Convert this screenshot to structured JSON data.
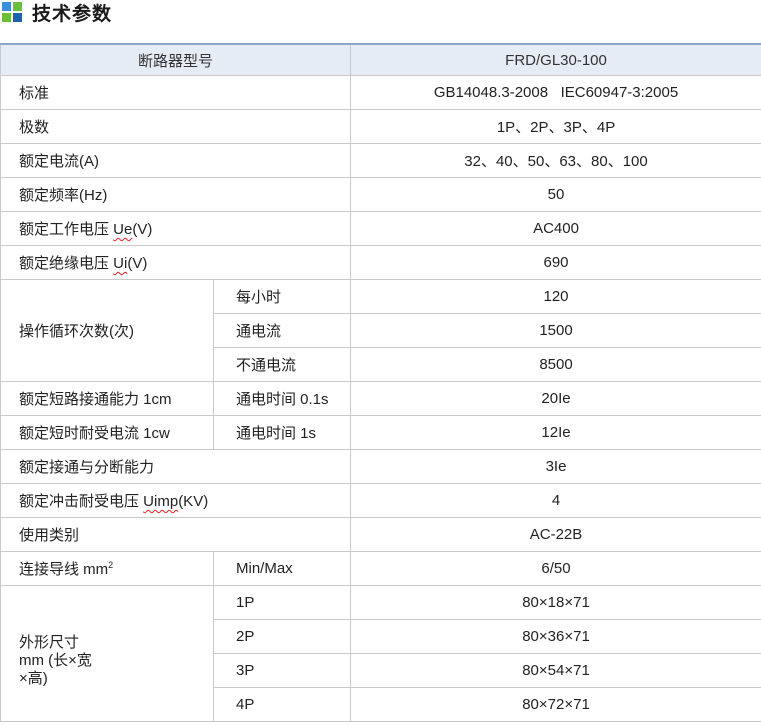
{
  "page": {
    "title": "技术参数"
  },
  "table": {
    "header": {
      "label": "断路器型号",
      "value": "FRD/GL30-100"
    },
    "rows": {
      "standard": {
        "label": "标准",
        "value": "GB14048.3-2008   IEC60947-3:2005"
      },
      "poles": {
        "label": "极数",
        "value": "1P、2P、3P、4P"
      },
      "current": {
        "label": "额定电流(A)",
        "value": "32、40、50、63、80、100"
      },
      "frequency": {
        "label": "额定频率(Hz)",
        "value": "50"
      },
      "voltage_ue": {
        "label_prefix": "额定工作电压 ",
        "label_unit": "Ue",
        "label_suffix": "(V)",
        "value": "AC400"
      },
      "voltage_ui": {
        "label_prefix": "额定绝缘电压 ",
        "label_unit": "Ui",
        "label_suffix": "(V)",
        "value": "690"
      },
      "cycles": {
        "label": "操作循环次数(次)",
        "sub": [
          {
            "label": "每小时",
            "value": "120"
          },
          {
            "label": "通电流",
            "value": "1500"
          },
          {
            "label": "不通电流",
            "value": "8500"
          }
        ]
      },
      "short_making": {
        "label": "额定短路接通能力 1cm",
        "sub": "通电时间 0.1s",
        "value": "20Ie"
      },
      "short_withstand": {
        "label": "额定短时耐受电流 1cw",
        "sub": "通电时间 1s",
        "value": "12Ie"
      },
      "making_breaking": {
        "label": "额定接通与分断能力",
        "value": "3Ie"
      },
      "impulse": {
        "label_prefix": "额定冲击耐受电压 ",
        "label_unit": "Uimp",
        "label_suffix": "(KV)",
        "value": "4"
      },
      "category": {
        "label": "使用类别",
        "value": "AC-22B"
      },
      "wire": {
        "label": "连接导线 mm",
        "label_sup": "2",
        "sub": "Min/Max",
        "value": "6/50"
      },
      "dimensions": {
        "label_line1": "外形尺寸",
        "label_line2": "mm (长×宽",
        "label_line3": "×高)",
        "sub": [
          {
            "label": "1P",
            "value": "80×18×71"
          },
          {
            "label": "2P",
            "value": "80×36×71"
          },
          {
            "label": "3P",
            "value": "80×54×71"
          },
          {
            "label": "4P",
            "value": "80×72×71"
          }
        ]
      }
    }
  },
  "colors": {
    "logo_blue": "#3a8ed8",
    "logo_green": "#6bbf3a",
    "logo_dark_blue": "#1e5fae",
    "header_bg": "#e6ecf5",
    "header_border": "#8aa6c8"
  }
}
